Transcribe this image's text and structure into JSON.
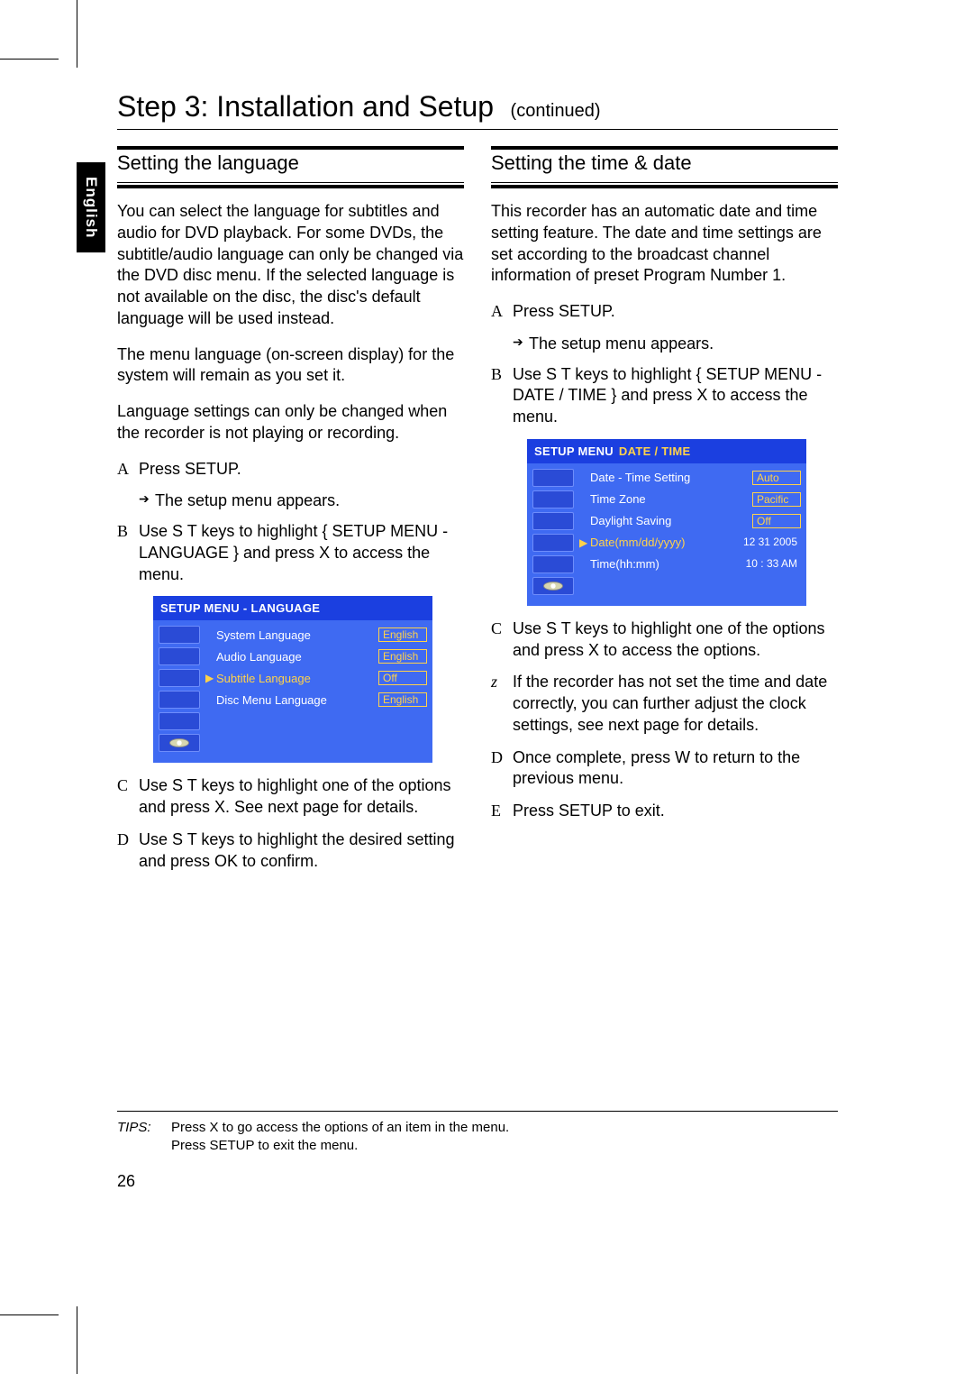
{
  "tab": "English",
  "title": "Step 3: Installation and Setup",
  "title_cont": "(continued)",
  "left": {
    "heading": "Setting the language",
    "p1": "You can select the language for subtitles and audio for DVD playback. For some DVDs, the subtitle/audio language can only be changed via the DVD disc menu. If the selected language is not available on the disc, the disc's default language will be used instead.",
    "p2": "The menu language (on-screen display) for the system will remain as you set it.",
    "p3": "Language settings can only be changed when the recorder is not playing or recording.",
    "stepA_letter": "A",
    "stepA_text": "Press SETUP.",
    "stepA_sub": "The setup menu appears.",
    "stepB_letter": "B",
    "stepB_text": "Use S T keys to highlight { SETUP MENU - LANGUAGE } and press X to access the menu.",
    "osd_title": "SETUP MENU - LANGUAGE",
    "osd_rows": [
      {
        "label": "System Language",
        "value": "English",
        "boxed": true
      },
      {
        "label": "Audio Language",
        "value": "English",
        "boxed": true
      },
      {
        "label": "Subtitle Language",
        "value": "Off",
        "boxed": true,
        "selected": true
      },
      {
        "label": "Disc Menu Language",
        "value": "English",
        "boxed": true
      }
    ],
    "stepC_letter": "C",
    "stepC_text": "Use S T keys to highlight one of the options and press X. See next page for details.",
    "stepD_letter": "D",
    "stepD_text": "Use S T keys to highlight the desired setting and press OK to confirm."
  },
  "right": {
    "heading": "Setting the time & date",
    "p1": "This recorder has an automatic date and time setting feature. The date and time settings are set according to the broadcast channel information of preset Program Number 1.",
    "stepA_letter": "A",
    "stepA_text": "Press SETUP.",
    "stepA_sub": "The setup menu appears.",
    "stepB_letter": "B",
    "stepB_text": "Use S T keys to highlight { SETUP MENU - DATE / TIME } and press X to access the menu.",
    "osd_title_a": "SETUP MENU",
    "osd_title_b": "DATE / TIME",
    "osd_rows": [
      {
        "label": "Date - Time Setting",
        "value": "Auto",
        "boxed": true
      },
      {
        "label": "Time Zone",
        "value": "Pacific",
        "boxed": true
      },
      {
        "label": "Daylight Saving",
        "value": "Off",
        "boxed": true
      },
      {
        "label": "Date(mm/dd/yyyy)",
        "value": "12 31 2005",
        "boxed": false,
        "selected": true
      },
      {
        "label": "Time(hh:mm)",
        "value": "10 : 33 AM",
        "boxed": false
      }
    ],
    "stepC_letter": "C",
    "stepC_text": "Use S T keys to highlight one of the options and press X to access the options.",
    "bullet_letter": "z",
    "bullet_text": "If the recorder has not set the time and date correctly, you can further adjust the clock settings, see next page for details.",
    "stepD_letter": "D",
    "stepD_text": "Once complete, press W to return to the previous menu.",
    "stepE_letter": "E",
    "stepE_text": "Press SETUP to exit."
  },
  "tips_label": "TIPS:",
  "tips_line1": "Press X to go access the options of an item in the menu.",
  "tips_line2": "Press SETUP to exit the menu.",
  "page_number": "26"
}
